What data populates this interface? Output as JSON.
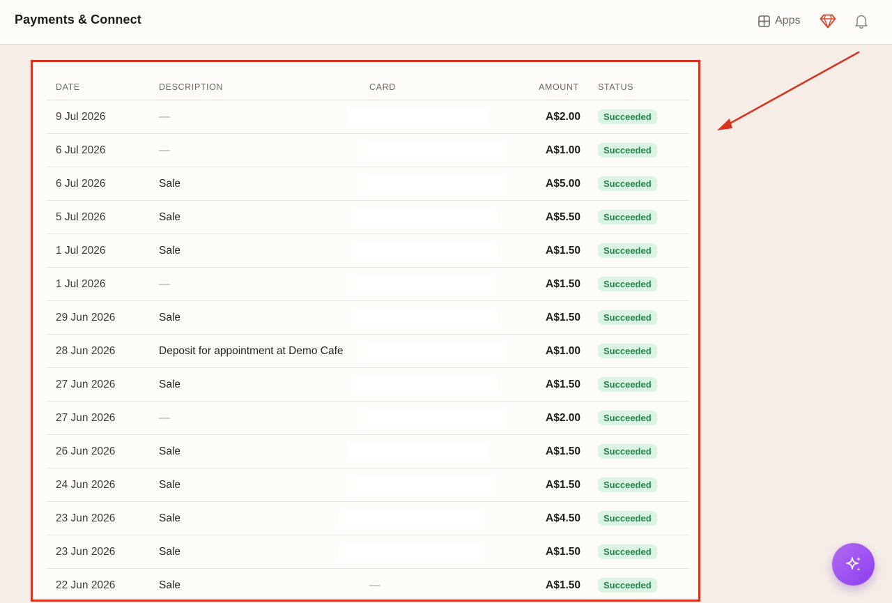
{
  "header": {
    "title": "Payments & Connect",
    "apps_label": "Apps",
    "icons": [
      "grid-icon",
      "gem-icon",
      "bell-icon"
    ]
  },
  "table": {
    "columns": {
      "date": "DATE",
      "description": "DESCRIPTION",
      "card": "CARD",
      "amount": "AMOUNT",
      "status": "STATUS"
    },
    "rows": [
      {
        "date": "9 Jul 2026",
        "description": "—",
        "card": "",
        "amount": "A$2.00",
        "status": "Succeeded"
      },
      {
        "date": "6 Jul 2026",
        "description": "—",
        "card": "",
        "amount": "A$1.00",
        "status": "Succeeded"
      },
      {
        "date": "6 Jul 2026",
        "description": "Sale",
        "card": "",
        "amount": "A$5.00",
        "status": "Succeeded"
      },
      {
        "date": "5 Jul 2026",
        "description": "Sale",
        "card": "",
        "amount": "A$5.50",
        "status": "Succeeded"
      },
      {
        "date": "1 Jul 2026",
        "description": "Sale",
        "card": "",
        "amount": "A$1.50",
        "status": "Succeeded"
      },
      {
        "date": "1 Jul 2026",
        "description": "—",
        "card": "",
        "amount": "A$1.50",
        "status": "Succeeded"
      },
      {
        "date": "29 Jun 2026",
        "description": "Sale",
        "card": "",
        "amount": "A$1.50",
        "status": "Succeeded"
      },
      {
        "date": "28 Jun 2026",
        "description": "Deposit for appointment at Demo Cafe",
        "card": "",
        "amount": "A$1.00",
        "status": "Succeeded"
      },
      {
        "date": "27 Jun 2026",
        "description": "Sale",
        "card": "",
        "amount": "A$1.50",
        "status": "Succeeded"
      },
      {
        "date": "27 Jun 2026",
        "description": "—",
        "card": "",
        "amount": "A$2.00",
        "status": "Succeeded"
      },
      {
        "date": "26 Jun 2026",
        "description": "Sale",
        "card": "",
        "amount": "A$1.50",
        "status": "Succeeded"
      },
      {
        "date": "24 Jun 2026",
        "description": "Sale",
        "card": "",
        "amount": "A$1.50",
        "status": "Succeeded"
      },
      {
        "date": "23 Jun 2026",
        "description": "Sale",
        "card": "",
        "amount": "A$4.50",
        "status": "Succeeded"
      },
      {
        "date": "23 Jun 2026",
        "description": "Sale",
        "card": "",
        "amount": "A$1.50",
        "status": "Succeeded"
      },
      {
        "date": "22 Jun 2026",
        "description": "Sale",
        "card": "—",
        "amount": "A$1.50",
        "status": "Succeeded"
      }
    ]
  },
  "colors": {
    "page_bg": "#f6eee6",
    "annotation_red": "#d8331f",
    "success_bg": "#d9f4e2",
    "success_text": "#22864a",
    "ai_button": "#9b4ff0"
  },
  "ai_button_icon": "sparkle-icon"
}
